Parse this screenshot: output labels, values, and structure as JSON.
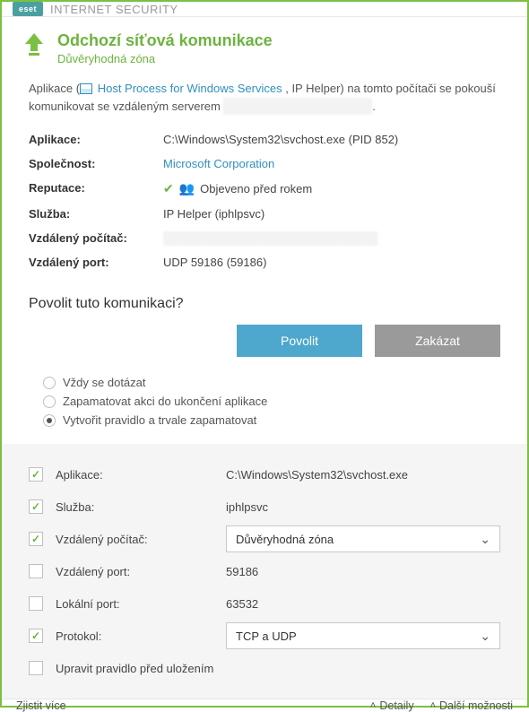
{
  "titlebar": {
    "logo": "eset",
    "product": "INTERNET SECURITY"
  },
  "header": {
    "title": "Odchozí síťová komunikace",
    "subtitle": "Důvěryhodná zóna"
  },
  "intro": {
    "prefix": "Aplikace (",
    "link": "Host Process for Windows Services",
    "mid": " , IP Helper) na tomto počítači se pokouší komunikovat se vzdáleným serverem ",
    "redacted": "██████████████████",
    "suffix": "."
  },
  "info": {
    "app_label": "Aplikace:",
    "app_value": "C:\\Windows\\System32\\svchost.exe (PID 852)",
    "company_label": "Společnost:",
    "company_value": "Microsoft Corporation",
    "reputation_label": "Reputace:",
    "reputation_value": "Objeveno před rokem",
    "service_label": "Služba:",
    "service_value": "IP Helper (iphlpsvc)",
    "remote_label": "Vzdálený počítač:",
    "remote_value": "██████████████████████████",
    "port_label": "Vzdálený port:",
    "port_value": "UDP 59186 (59186)"
  },
  "question": "Povolit tuto komunikaci?",
  "buttons": {
    "allow": "Povolit",
    "deny": "Zakázat"
  },
  "radios": {
    "ask": "Vždy se dotázat",
    "remember_until_exit": "Zapamatovat akci do ukončení aplikace",
    "create_rule": "Vytvořit pravidlo a trvale zapamatovat"
  },
  "rule": {
    "app_label": "Aplikace:",
    "app_value": "C:\\Windows\\System32\\svchost.exe",
    "service_label": "Služba:",
    "service_value": "iphlpsvc",
    "remote_pc_label": "Vzdálený počítač:",
    "remote_pc_value": "Důvěryhodná zóna",
    "remote_port_label": "Vzdálený port:",
    "remote_port_value": "59186",
    "local_port_label": "Lokální port:",
    "local_port_value": "63532",
    "protocol_label": "Protokol:",
    "protocol_value": "TCP a UDP",
    "edit_before_save": "Upravit pravidlo před uložením"
  },
  "footer": {
    "learn_more": "Zjistit více",
    "details": "Detaily",
    "more_options": "Další možnosti"
  }
}
